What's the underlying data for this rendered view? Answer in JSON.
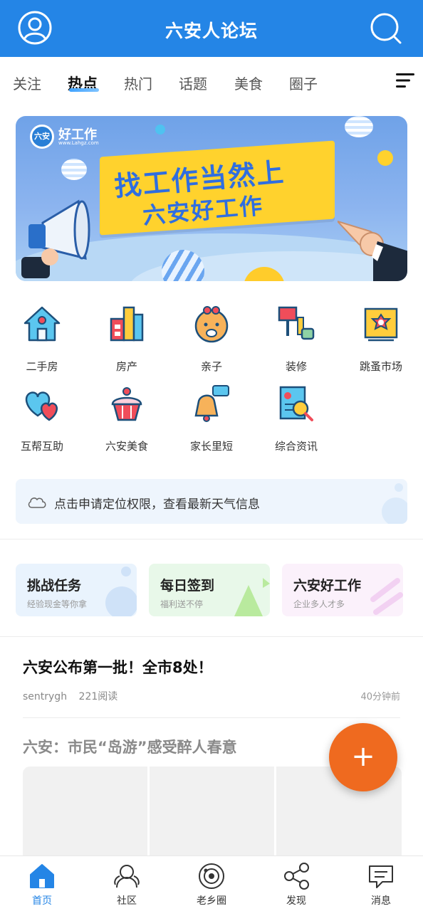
{
  "header": {
    "title": "六安人论坛"
  },
  "tabs": [
    {
      "label": "关注"
    },
    {
      "label": "热点"
    },
    {
      "label": "热门"
    },
    {
      "label": "话题"
    },
    {
      "label": "美食"
    },
    {
      "label": "圈子"
    }
  ],
  "banner": {
    "logo_badge": "六安",
    "logo_text": "好工作",
    "logo_url": "www.Lahgz.com",
    "line1": "找工作当然上",
    "line2": "六安好工作"
  },
  "categories": [
    {
      "label": "二手房",
      "icon": "house-icon"
    },
    {
      "label": "房产",
      "icon": "buildings-icon"
    },
    {
      "label": "亲子",
      "icon": "baby-icon"
    },
    {
      "label": "装修",
      "icon": "paint-roller-icon"
    },
    {
      "label": "跳蚤市场",
      "icon": "badge-icon"
    },
    {
      "label": "互帮互助",
      "icon": "hearts-icon"
    },
    {
      "label": "六安美食",
      "icon": "cupcake-icon"
    },
    {
      "label": "家长里短",
      "icon": "bell-chat-icon"
    },
    {
      "label": "综合资讯",
      "icon": "report-search-icon"
    }
  ],
  "weather": {
    "text": "点击申请定位权限，查看最新天气信息"
  },
  "cards": [
    {
      "title": "挑战任务",
      "subtitle": "经验现金等你拿"
    },
    {
      "title": "每日签到",
      "subtitle": "福利送不停"
    },
    {
      "title": "六安好工作",
      "subtitle": "企业多人才多"
    }
  ],
  "posts": [
    {
      "title": "六安公布第一批！全市8处！",
      "author": "sentrygh",
      "reads": "221阅读",
      "time": "40分钟前"
    },
    {
      "title": "六安：市民“岛游”感受醉人春意"
    }
  ],
  "fab": {
    "label": "+"
  },
  "bottom_nav": [
    {
      "label": "首页",
      "icon": "home-icon",
      "active": true
    },
    {
      "label": "社区",
      "icon": "community-icon"
    },
    {
      "label": "老乡圈",
      "icon": "planet-icon"
    },
    {
      "label": "发现",
      "icon": "share-icon"
    },
    {
      "label": "消息",
      "icon": "message-icon"
    }
  ],
  "colors": {
    "primary": "#2485e6",
    "fab": "#ef6a1f"
  }
}
